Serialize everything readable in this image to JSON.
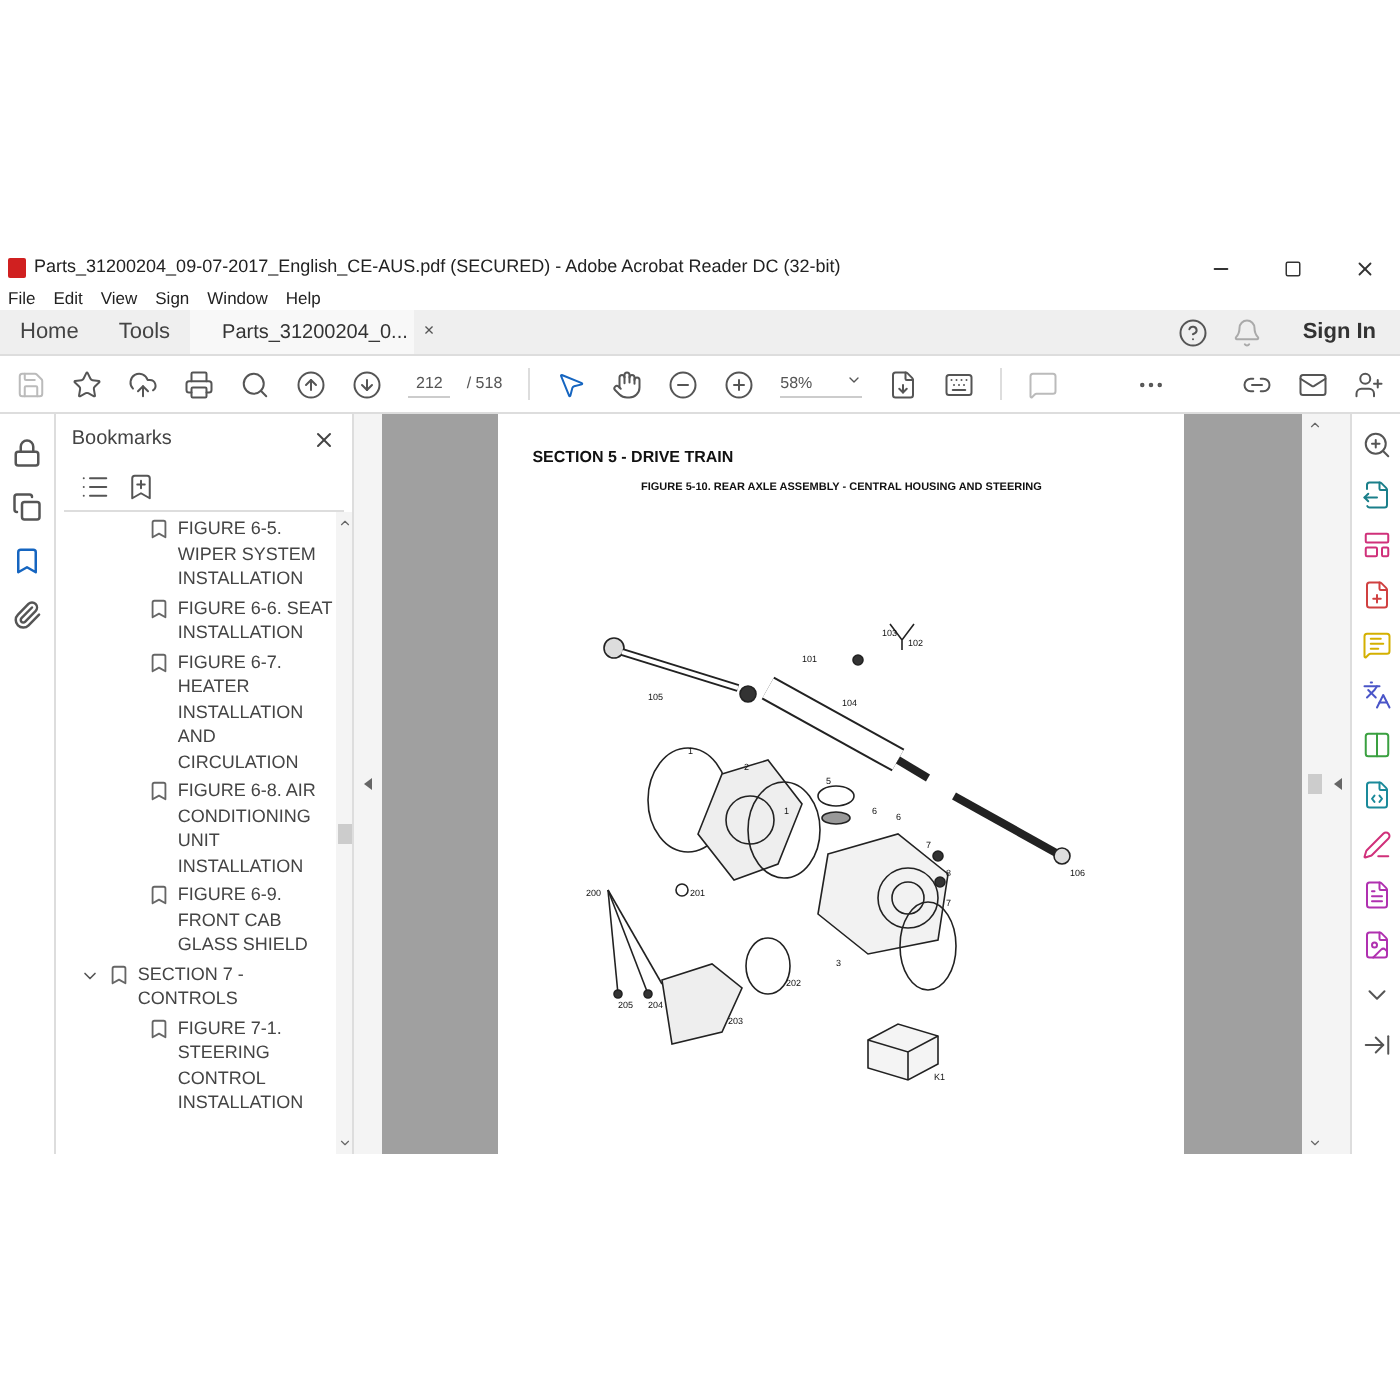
{
  "window": {
    "title": "Parts_31200204_09-07-2017_English_CE-AUS.pdf (SECURED) - Adobe Acrobat Reader DC (32-bit)"
  },
  "menu": [
    "File",
    "Edit",
    "View",
    "Sign",
    "Window",
    "Help"
  ],
  "tabs": [
    {
      "label": "Home",
      "selected": false,
      "kind": "nav"
    },
    {
      "label": "Tools",
      "selected": false,
      "kind": "nav"
    },
    {
      "label": "Parts_31200204_0...",
      "selected": true,
      "kind": "doc",
      "close": "×"
    }
  ],
  "sign_in": "Sign In",
  "toolbar": {
    "page": "212",
    "page_total": "/ 518",
    "zoom": "58%"
  },
  "left_rail": [
    {
      "selected": false
    },
    {
      "selected": false
    },
    {
      "selected": true
    },
    {
      "selected": false
    }
  ],
  "bookmarks": {
    "title": "Bookmarks",
    "items": [
      {
        "kind": "figure",
        "label": "FIGURE 6-5. WIPER SYSTEM INSTALLATION"
      },
      {
        "kind": "figure",
        "label": "FIGURE 6-6. SEAT INSTALLATION"
      },
      {
        "kind": "figure",
        "label": "FIGURE 6-7. HEATER INSTALLATION AND CIRCULATION"
      },
      {
        "kind": "figure",
        "label": "FIGURE 6-8. AIR CONDITIONING UNIT INSTALLATION"
      },
      {
        "kind": "figure",
        "label": "FIGURE 6-9. FRONT CAB GLASS SHIELD"
      },
      {
        "kind": "section",
        "label": "SECTION 7 - CONTROLS",
        "expanded": true,
        "children": [
          {
            "kind": "figure",
            "label": "FIGURE 7-1. STEERING CONTROL INSTALLATION"
          }
        ]
      }
    ]
  },
  "document": {
    "section": "SECTION 5 - DRIVE TRAIN",
    "figure_title": "FIGURE 5-10. REAR AXLE ASSEMBLY - CENTRAL HOUSING AND STEERING",
    "part_labels": [
      "105",
      "101",
      "103",
      "102",
      "104",
      "1",
      "2",
      "1",
      "5",
      "6",
      "6",
      "7",
      "8",
      "7",
      "3",
      "106",
      "200",
      "201",
      "202",
      "203",
      "204",
      "205",
      "K1"
    ]
  }
}
